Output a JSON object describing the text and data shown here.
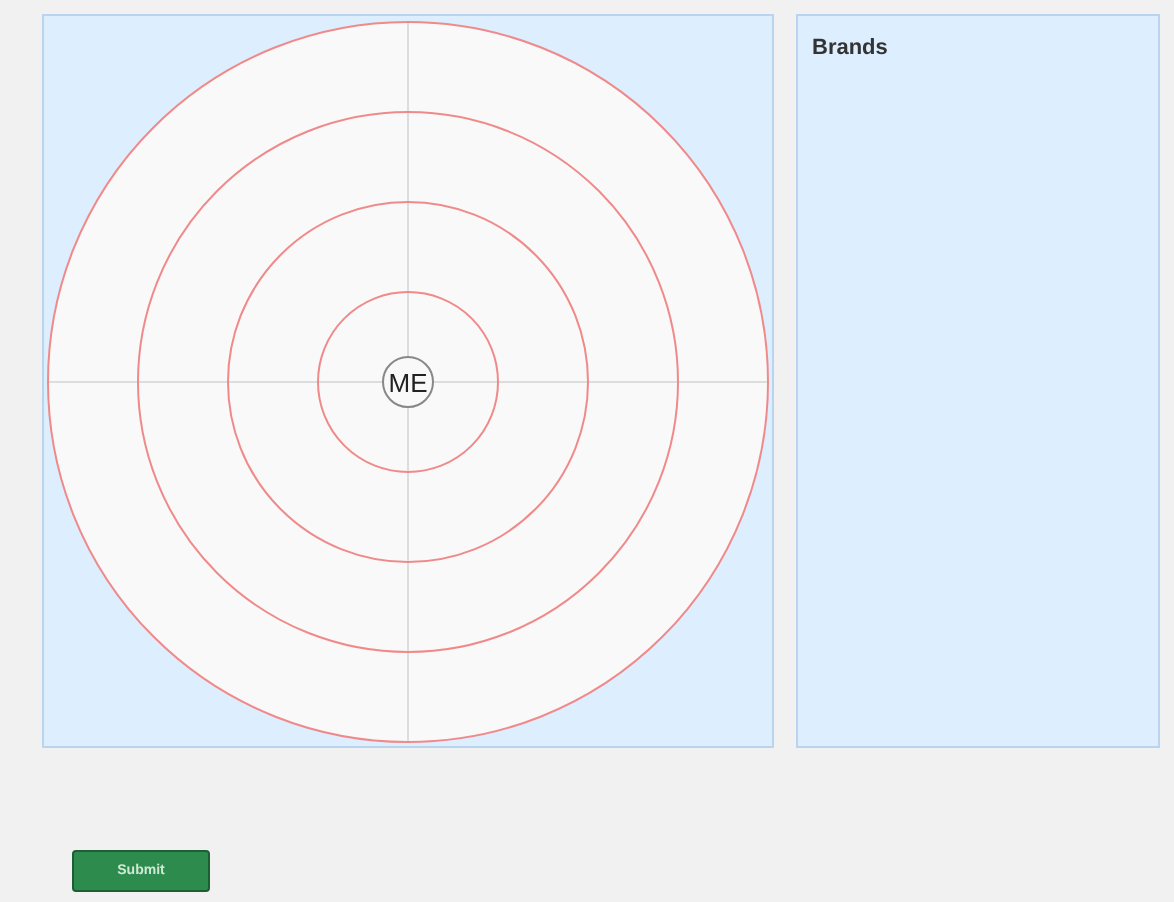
{
  "radar": {
    "center_label": "ME"
  },
  "brands_panel": {
    "title": "Brands"
  },
  "submit_button": {
    "label": "Submit"
  }
}
